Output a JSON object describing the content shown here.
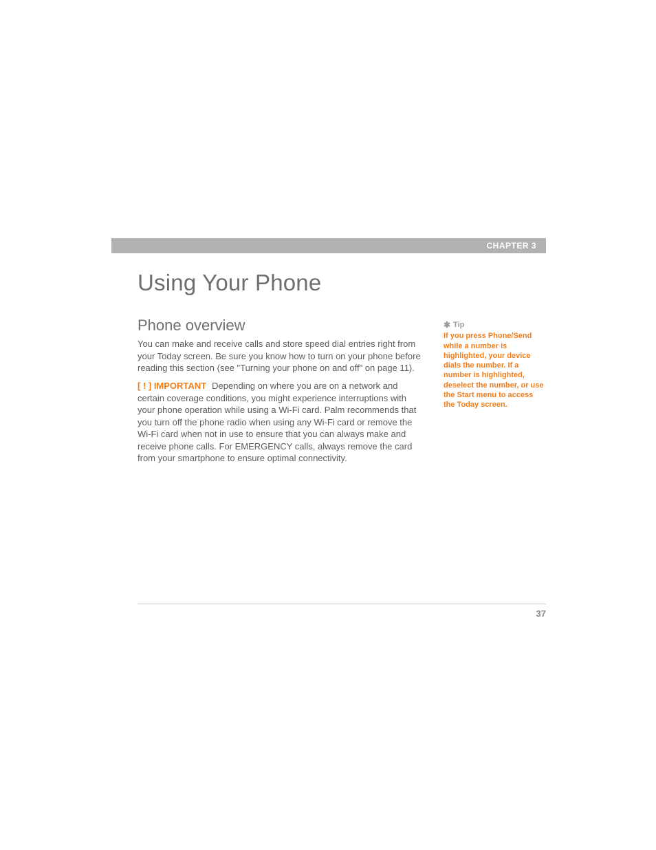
{
  "chapter_label": "CHAPTER 3",
  "title": "Using Your Phone",
  "section_heading": "Phone overview",
  "intro_paragraph": "You can make and receive calls and store speed dial entries right from your Today screen. Be sure you know how to turn on your phone before reading this section (see \"Turning your phone on and off\" on page 11).",
  "important_label": "[ ! ] IMPORTANT",
  "important_text": "Depending on where you are on a network and certain coverage conditions, you might experience interruptions with your phone operation while using a Wi-Fi card. Palm recommends that you turn off the phone radio when using any Wi-Fi card or remove the Wi-Fi card when not in use to ensure that you can always make and receive phone calls. For EMERGENCY calls, always remove the card from your smartphone to ensure optimal connectivity.",
  "sidebar": {
    "icon": "✱",
    "tip_label": "Tip",
    "tip_body": "If you press Phone/Send while a number is highlighted, your device dials the number. If a number is highlighted, deselect the number, or use the Start menu to access the Today screen."
  },
  "page_number": "37"
}
